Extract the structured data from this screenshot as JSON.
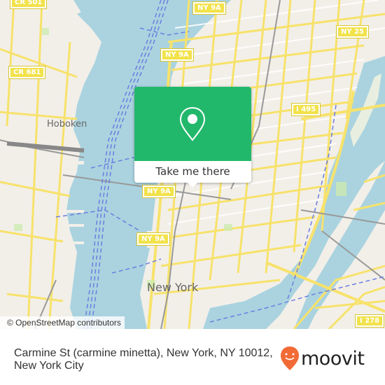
{
  "map": {
    "colors": {
      "land": "#f2efe9",
      "water": "#aad3df",
      "major_road": "#f7e26b",
      "minor_road": "#ffffff",
      "ferry": "#6c7de0",
      "rail": "#999999",
      "park": "#cdebb0"
    },
    "route_shields": [
      {
        "label": "CR 501"
      },
      {
        "label": "NY 9A"
      },
      {
        "label": "NY 25"
      },
      {
        "label": "CR 681"
      },
      {
        "label": "NY 9A"
      },
      {
        "label": "I 495"
      },
      {
        "label": "NY 9A"
      },
      {
        "label": "NY 9A"
      },
      {
        "label": "I 278"
      }
    ],
    "place_labels": [
      {
        "label": "Hoboken"
      },
      {
        "label": "New York"
      }
    ],
    "attribution": "© OpenStreetMap contributors"
  },
  "popup": {
    "icon": "map-pin-icon",
    "button_label": "Take me there",
    "color": "#22b86b"
  },
  "footer": {
    "address_line1": "Carmine St (carmine minetta), New York, NY 10012,",
    "address_line2": "New York City",
    "brand": "moovit",
    "brand_color": "#f26a36"
  }
}
